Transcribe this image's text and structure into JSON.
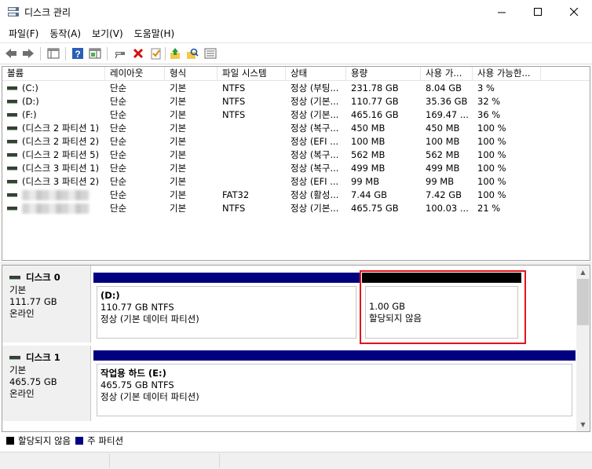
{
  "window": {
    "title": "디스크 관리"
  },
  "menu": {
    "items": [
      "파일(F)",
      "동작(A)",
      "보기(V)",
      "도움말(H)"
    ]
  },
  "colors": {
    "primary_partition": "#000080",
    "unallocated": "#000000",
    "highlight": "#e3141c"
  },
  "volume_table": {
    "headers": [
      "볼륨",
      "레이아웃",
      "형식",
      "파일 시스템",
      "상태",
      "용량",
      "사용 가...",
      "사용 가능한..."
    ],
    "rows": [
      {
        "name": "(C:)",
        "layout": "단순",
        "type": "기본",
        "fs": "NTFS",
        "status": "정상 (부팅...",
        "capacity": "231.78 GB",
        "free": "8.04 GB",
        "pct": "3 %"
      },
      {
        "name": "(D:)",
        "layout": "단순",
        "type": "기본",
        "fs": "NTFS",
        "status": "정상 (기본...",
        "capacity": "110.77 GB",
        "free": "35.36 GB",
        "pct": "32 %"
      },
      {
        "name": "(F:)",
        "layout": "단순",
        "type": "기본",
        "fs": "NTFS",
        "status": "정상 (기본...",
        "capacity": "465.16 GB",
        "free": "169.47 ...",
        "pct": "36 %"
      },
      {
        "name": "(디스크 2 파티션 1)",
        "layout": "단순",
        "type": "기본",
        "fs": "",
        "status": "정상 (복구...",
        "capacity": "450 MB",
        "free": "450 MB",
        "pct": "100 %"
      },
      {
        "name": "(디스크 2 파티션 2)",
        "layout": "단순",
        "type": "기본",
        "fs": "",
        "status": "정상 (EFI ...",
        "capacity": "100 MB",
        "free": "100 MB",
        "pct": "100 %"
      },
      {
        "name": "(디스크 2 파티션 5)",
        "layout": "단순",
        "type": "기본",
        "fs": "",
        "status": "정상 (복구...",
        "capacity": "562 MB",
        "free": "562 MB",
        "pct": "100 %"
      },
      {
        "name": "(디스크 3 파티션 1)",
        "layout": "단순",
        "type": "기본",
        "fs": "",
        "status": "정상 (복구...",
        "capacity": "499 MB",
        "free": "499 MB",
        "pct": "100 %"
      },
      {
        "name": "(디스크 3 파티션 2)",
        "layout": "단순",
        "type": "기본",
        "fs": "",
        "status": "정상 (EFI ...",
        "capacity": "99 MB",
        "free": "99 MB",
        "pct": "100 %"
      },
      {
        "name": "",
        "layout": "단순",
        "type": "기본",
        "fs": "FAT32",
        "status": "정상 (활성...",
        "capacity": "7.44 GB",
        "free": "7.42 GB",
        "pct": "100 %"
      },
      {
        "name": "",
        "layout": "단순",
        "type": "기본",
        "fs": "NTFS",
        "status": "정상 (기본...",
        "capacity": "465.75 GB",
        "free": "100.03 ...",
        "pct": "21 %"
      }
    ]
  },
  "disks": [
    {
      "name": "디스크 0",
      "type": "기본",
      "size": "111.77 GB",
      "status": "온라인",
      "partitions": [
        {
          "label": "(D:)",
          "size": "110.77 GB NTFS",
          "status": "정상 (기본 데이터 파티션)"
        },
        {
          "label": "",
          "size": "1.00 GB",
          "status": "할당되지 않음"
        }
      ]
    },
    {
      "name": "디스크 1",
      "type": "기본",
      "size": "465.75 GB",
      "status": "온라인",
      "partitions": [
        {
          "label": "작업용 하드  (E:)",
          "size": "465.75 GB NTFS",
          "status": "정상 (기본 데이터 파티션)"
        }
      ]
    }
  ],
  "legend": {
    "unallocated": "할당되지 않음",
    "primary": "주 파티션"
  }
}
